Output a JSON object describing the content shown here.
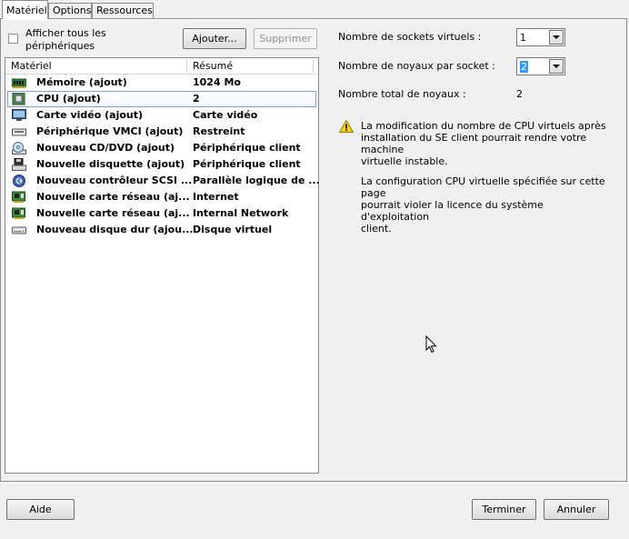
{
  "tabs": [
    {
      "label": "Matériel",
      "active": true
    },
    {
      "label": "Options",
      "active": false
    },
    {
      "label": "Ressources",
      "active": false
    }
  ],
  "left": {
    "show_all_label": "Afficher tous les périphériques",
    "show_all_line1": "Afficher tous les",
    "show_all_line2": "périphériques",
    "add_button": "Ajouter...",
    "remove_button": "Supprimer",
    "columns": {
      "hardware": "Matériel",
      "summary": "Résumé"
    },
    "rows": [
      {
        "icon": "memory-icon",
        "name": "Mémoire (ajout)",
        "summary": "1024 Mo"
      },
      {
        "icon": "cpu-icon",
        "name": "CPU (ajout)",
        "summary": "2",
        "selected": true
      },
      {
        "icon": "monitor-icon",
        "name": "Carte vidéo  (ajout)",
        "summary": "Carte vidéo"
      },
      {
        "icon": "vmci-icon",
        "name": "Périphérique VMCI (ajout)",
        "summary": "Restreint"
      },
      {
        "icon": "cd-dvd-icon",
        "name": "Nouveau CD/DVD (ajout)",
        "summary": "Périphérique client"
      },
      {
        "icon": "floppy-icon",
        "name": "Nouvelle disquette (ajout)",
        "summary": "Périphérique client"
      },
      {
        "icon": "scsi-controller-icon",
        "name": "Nouveau contrôleur SCSI ...",
        "summary": "Parallèle logique de ..."
      },
      {
        "icon": "network-card-icon",
        "name": "Nouvelle carte réseau (aj...",
        "summary": "Internet"
      },
      {
        "icon": "network-card-icon",
        "name": "Nouvelle carte réseau (aj...",
        "summary": "Internal Network"
      },
      {
        "icon": "hard-disk-icon",
        "name": "Nouveau disque dur (ajou...",
        "summary": "Disque virtuel"
      }
    ]
  },
  "right": {
    "sockets_label": "Nombre de sockets virtuels :",
    "sockets_value": "1",
    "cores_label": "Nombre de noyaux par socket :",
    "cores_value": "2",
    "total_label": "Nombre total de noyaux :",
    "total_value": "2",
    "warning_line1": "La modification du nombre de CPU virtuels après",
    "warning_line2": "installation du SE client pourrait rendre votre machine",
    "warning_line3": "virtuelle instable.",
    "license_line1": "La configuration CPU virtuelle spécifiée sur cette page",
    "license_line2": "pourrait violer la licence du système d'exploitation",
    "license_line3": "client."
  },
  "footer": {
    "help_button": "Aide",
    "finish_button": "Terminer",
    "cancel_button": "Annuler"
  }
}
